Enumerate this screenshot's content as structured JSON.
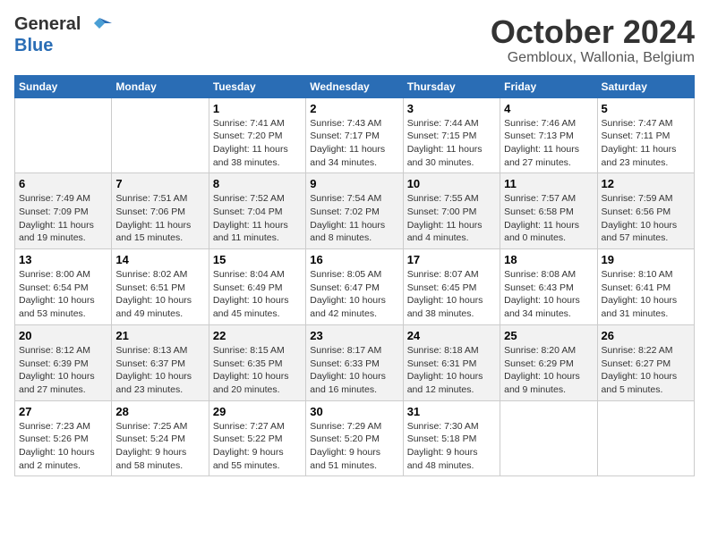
{
  "header": {
    "logo_general": "General",
    "logo_blue": "Blue",
    "month": "October 2024",
    "location": "Gembloux, Wallonia, Belgium"
  },
  "weekdays": [
    "Sunday",
    "Monday",
    "Tuesday",
    "Wednesday",
    "Thursday",
    "Friday",
    "Saturday"
  ],
  "weeks": [
    [
      {
        "day": "",
        "info": ""
      },
      {
        "day": "",
        "info": ""
      },
      {
        "day": "1",
        "info": "Sunrise: 7:41 AM\nSunset: 7:20 PM\nDaylight: 11 hours\nand 38 minutes."
      },
      {
        "day": "2",
        "info": "Sunrise: 7:43 AM\nSunset: 7:17 PM\nDaylight: 11 hours\nand 34 minutes."
      },
      {
        "day": "3",
        "info": "Sunrise: 7:44 AM\nSunset: 7:15 PM\nDaylight: 11 hours\nand 30 minutes."
      },
      {
        "day": "4",
        "info": "Sunrise: 7:46 AM\nSunset: 7:13 PM\nDaylight: 11 hours\nand 27 minutes."
      },
      {
        "day": "5",
        "info": "Sunrise: 7:47 AM\nSunset: 7:11 PM\nDaylight: 11 hours\nand 23 minutes."
      }
    ],
    [
      {
        "day": "6",
        "info": "Sunrise: 7:49 AM\nSunset: 7:09 PM\nDaylight: 11 hours\nand 19 minutes."
      },
      {
        "day": "7",
        "info": "Sunrise: 7:51 AM\nSunset: 7:06 PM\nDaylight: 11 hours\nand 15 minutes."
      },
      {
        "day": "8",
        "info": "Sunrise: 7:52 AM\nSunset: 7:04 PM\nDaylight: 11 hours\nand 11 minutes."
      },
      {
        "day": "9",
        "info": "Sunrise: 7:54 AM\nSunset: 7:02 PM\nDaylight: 11 hours\nand 8 minutes."
      },
      {
        "day": "10",
        "info": "Sunrise: 7:55 AM\nSunset: 7:00 PM\nDaylight: 11 hours\nand 4 minutes."
      },
      {
        "day": "11",
        "info": "Sunrise: 7:57 AM\nSunset: 6:58 PM\nDaylight: 11 hours\nand 0 minutes."
      },
      {
        "day": "12",
        "info": "Sunrise: 7:59 AM\nSunset: 6:56 PM\nDaylight: 10 hours\nand 57 minutes."
      }
    ],
    [
      {
        "day": "13",
        "info": "Sunrise: 8:00 AM\nSunset: 6:54 PM\nDaylight: 10 hours\nand 53 minutes."
      },
      {
        "day": "14",
        "info": "Sunrise: 8:02 AM\nSunset: 6:51 PM\nDaylight: 10 hours\nand 49 minutes."
      },
      {
        "day": "15",
        "info": "Sunrise: 8:04 AM\nSunset: 6:49 PM\nDaylight: 10 hours\nand 45 minutes."
      },
      {
        "day": "16",
        "info": "Sunrise: 8:05 AM\nSunset: 6:47 PM\nDaylight: 10 hours\nand 42 minutes."
      },
      {
        "day": "17",
        "info": "Sunrise: 8:07 AM\nSunset: 6:45 PM\nDaylight: 10 hours\nand 38 minutes."
      },
      {
        "day": "18",
        "info": "Sunrise: 8:08 AM\nSunset: 6:43 PM\nDaylight: 10 hours\nand 34 minutes."
      },
      {
        "day": "19",
        "info": "Sunrise: 8:10 AM\nSunset: 6:41 PM\nDaylight: 10 hours\nand 31 minutes."
      }
    ],
    [
      {
        "day": "20",
        "info": "Sunrise: 8:12 AM\nSunset: 6:39 PM\nDaylight: 10 hours\nand 27 minutes."
      },
      {
        "day": "21",
        "info": "Sunrise: 8:13 AM\nSunset: 6:37 PM\nDaylight: 10 hours\nand 23 minutes."
      },
      {
        "day": "22",
        "info": "Sunrise: 8:15 AM\nSunset: 6:35 PM\nDaylight: 10 hours\nand 20 minutes."
      },
      {
        "day": "23",
        "info": "Sunrise: 8:17 AM\nSunset: 6:33 PM\nDaylight: 10 hours\nand 16 minutes."
      },
      {
        "day": "24",
        "info": "Sunrise: 8:18 AM\nSunset: 6:31 PM\nDaylight: 10 hours\nand 12 minutes."
      },
      {
        "day": "25",
        "info": "Sunrise: 8:20 AM\nSunset: 6:29 PM\nDaylight: 10 hours\nand 9 minutes."
      },
      {
        "day": "26",
        "info": "Sunrise: 8:22 AM\nSunset: 6:27 PM\nDaylight: 10 hours\nand 5 minutes."
      }
    ],
    [
      {
        "day": "27",
        "info": "Sunrise: 7:23 AM\nSunset: 5:26 PM\nDaylight: 10 hours\nand 2 minutes."
      },
      {
        "day": "28",
        "info": "Sunrise: 7:25 AM\nSunset: 5:24 PM\nDaylight: 9 hours\nand 58 minutes."
      },
      {
        "day": "29",
        "info": "Sunrise: 7:27 AM\nSunset: 5:22 PM\nDaylight: 9 hours\nand 55 minutes."
      },
      {
        "day": "30",
        "info": "Sunrise: 7:29 AM\nSunset: 5:20 PM\nDaylight: 9 hours\nand 51 minutes."
      },
      {
        "day": "31",
        "info": "Sunrise: 7:30 AM\nSunset: 5:18 PM\nDaylight: 9 hours\nand 48 minutes."
      },
      {
        "day": "",
        "info": ""
      },
      {
        "day": "",
        "info": ""
      }
    ]
  ]
}
